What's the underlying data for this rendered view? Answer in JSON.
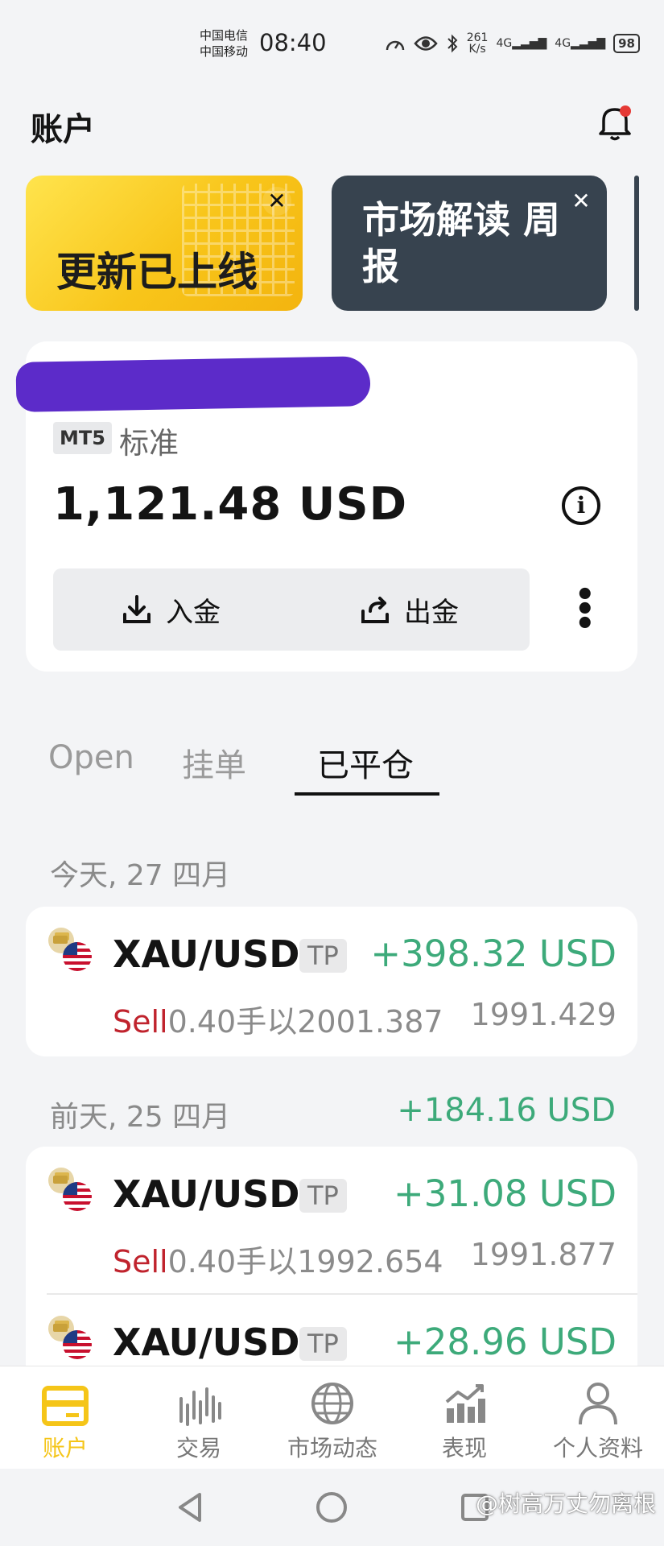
{
  "status_bar": {
    "carrier1": "中国电信",
    "carrier2": "中国移动",
    "time": "08:40",
    "net_speed_value": "261",
    "net_speed_unit": "K/s",
    "signal_label_1": "4G",
    "signal_label_2": "4G",
    "battery": "98"
  },
  "header": {
    "title": "账户"
  },
  "banners": [
    {
      "text": "更新已上线"
    },
    {
      "text": "市场解读 周报"
    }
  ],
  "account": {
    "platform_badge": "MT5",
    "type": "标准",
    "balance": "1,121.48 USD",
    "deposit_label": "入金",
    "withdraw_label": "出金"
  },
  "tabs": [
    {
      "label": "Open"
    },
    {
      "label": "挂单"
    },
    {
      "label": "已平仓",
      "active": true
    }
  ],
  "groups": [
    {
      "date": "今天, 27 四月",
      "total": "",
      "trades": [
        {
          "symbol": "XAU/USD",
          "tag": "TP",
          "pnl": "+398.32 USD",
          "side": "Sell",
          "detail": "0.40手以2001.387",
          "close": "1991.429"
        }
      ]
    },
    {
      "date": "前天, 25 四月",
      "total": "+184.16 USD",
      "trades": [
        {
          "symbol": "XAU/USD",
          "tag": "TP",
          "pnl": "+31.08 USD",
          "side": "Sell",
          "detail": "0.40手以1992.654",
          "close": "1991.877"
        },
        {
          "symbol": "XAU/USD",
          "tag": "TP",
          "pnl": "+28.96 USD",
          "side": "",
          "detail": "",
          "close": ""
        }
      ]
    }
  ],
  "bottom_nav": [
    {
      "label": "账户",
      "icon": "wallet-icon",
      "active": true
    },
    {
      "label": "交易",
      "icon": "bars-icon"
    },
    {
      "label": "市场动态",
      "icon": "globe-icon"
    },
    {
      "label": "表现",
      "icon": "chart-icon"
    },
    {
      "label": "个人资料",
      "icon": "person-icon"
    }
  ],
  "watermark": "@树高万丈勿离根",
  "colors": {
    "accent": "#f5c518",
    "profit": "#3daa7a",
    "sell": "#c0232d",
    "banner_dark": "#37434f"
  }
}
